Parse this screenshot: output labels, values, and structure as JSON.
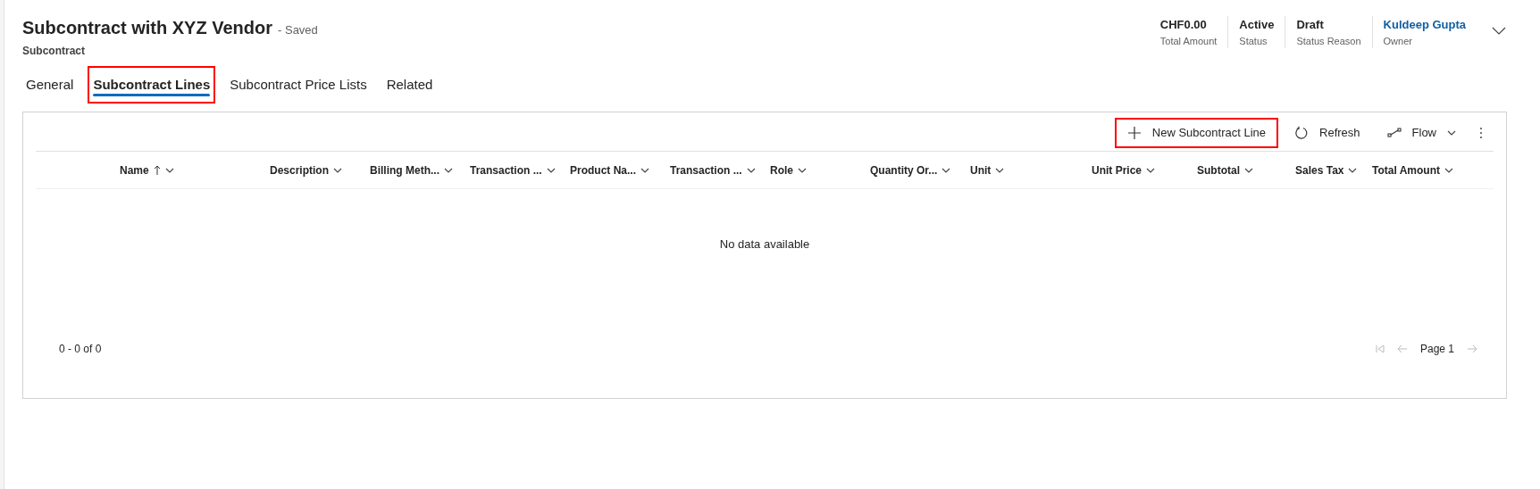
{
  "header": {
    "title": "Subcontract with XYZ Vendor",
    "save_state": "- Saved",
    "entity": "Subcontract",
    "fields": [
      {
        "value": "CHF0.00",
        "label": "Total Amount",
        "kind": "text"
      },
      {
        "value": "Active",
        "label": "Status",
        "kind": "text"
      },
      {
        "value": "Draft",
        "label": "Status Reason",
        "kind": "text"
      },
      {
        "value": "Kuldeep Gupta",
        "label": "Owner",
        "kind": "link"
      }
    ]
  },
  "tabs": [
    {
      "label": "General",
      "selected": false,
      "highlighted": false
    },
    {
      "label": "Subcontract Lines",
      "selected": true,
      "highlighted": true
    },
    {
      "label": "Subcontract Price Lists",
      "selected": false,
      "highlighted": false
    },
    {
      "label": "Related",
      "selected": false,
      "highlighted": false
    }
  ],
  "toolbar": [
    {
      "label": "New Subcontract Line",
      "kind": "new",
      "highlighted": true
    },
    {
      "label": "Refresh",
      "kind": "refresh",
      "highlighted": false
    },
    {
      "label": "Flow",
      "kind": "flow",
      "highlighted": false
    }
  ],
  "table": {
    "columns": [
      {
        "label": "Name",
        "sorted": true
      },
      {
        "label": "Description",
        "sorted": false
      },
      {
        "label": "Billing Meth...",
        "sorted": false
      },
      {
        "label": "Transaction ...",
        "sorted": false
      },
      {
        "label": "Product Na...",
        "sorted": false
      },
      {
        "label": "Transaction ...",
        "sorted": false
      },
      {
        "label": "Role",
        "sorted": false
      },
      {
        "label": "Quantity Or...",
        "sorted": false
      },
      {
        "label": "Unit",
        "sorted": false
      },
      {
        "label": "Unit Price",
        "sorted": false
      },
      {
        "label": "Subtotal",
        "sorted": false
      },
      {
        "label": "Sales Tax",
        "sorted": false
      },
      {
        "label": "Total Amount",
        "sorted": false
      }
    ],
    "empty_message": "No data available"
  },
  "footer": {
    "record_count": "0 - 0 of 0",
    "page": "Page 1"
  }
}
